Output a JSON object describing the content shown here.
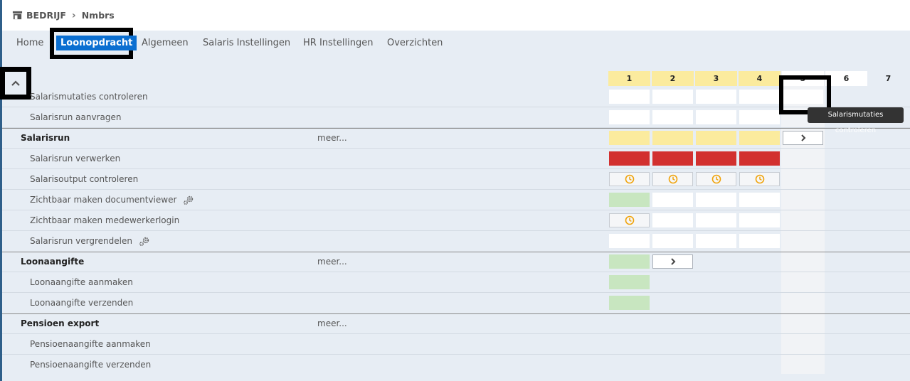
{
  "breadcrumb": {
    "root": "BEDRIJF",
    "current": "Nmbrs"
  },
  "tabs": [
    {
      "label": "Home",
      "active": false
    },
    {
      "label": "Loonopdracht",
      "active": true
    },
    {
      "label": "Algemeen",
      "active": false
    },
    {
      "label": "Salaris Instellingen",
      "active": false
    },
    {
      "label": "HR Instellingen",
      "active": false
    },
    {
      "label": "Overzichten",
      "active": false
    }
  ],
  "columns": [
    "1",
    "2",
    "3",
    "4",
    "5",
    "6",
    "7"
  ],
  "meer": "meer...",
  "rows": [
    {
      "label": "Salarismutaties controleren",
      "type": "sub"
    },
    {
      "label": "Salarisrun aanvragen",
      "type": "sub"
    },
    {
      "label": "Salarisrun",
      "type": "group"
    },
    {
      "label": "Salarisrun verwerken",
      "type": "sub"
    },
    {
      "label": "Salarisoutput controleren",
      "type": "sub"
    },
    {
      "label": "Zichtbaar maken documentviewer",
      "type": "sub"
    },
    {
      "label": "Zichtbaar maken medewerkerlogin",
      "type": "sub"
    },
    {
      "label": "Salarisrun vergrendelen",
      "type": "sub"
    },
    {
      "label": "Loonaangifte",
      "type": "group"
    },
    {
      "label": "Loonaangifte aanmaken",
      "type": "sub"
    },
    {
      "label": "Loonaangifte verzenden",
      "type": "sub"
    },
    {
      "label": "Pensioen export",
      "type": "group"
    },
    {
      "label": "Pensioenaangifte aanmaken",
      "type": "sub"
    },
    {
      "label": "Pensioenaangifte verzenden",
      "type": "sub"
    }
  ],
  "tooltip": "Salarismutaties controleren",
  "icons": {
    "company": "store-icon",
    "chevron": "chevron-right-icon",
    "collapse": "chevron-up-icon",
    "clock": "clock-icon",
    "gear": "gear-icon"
  },
  "colors": {
    "accent": "#0b6fd1",
    "yellow": "#fbeb9e",
    "red": "#d2302f",
    "green": "#c8e6c0",
    "clock": "#f0a30a"
  }
}
